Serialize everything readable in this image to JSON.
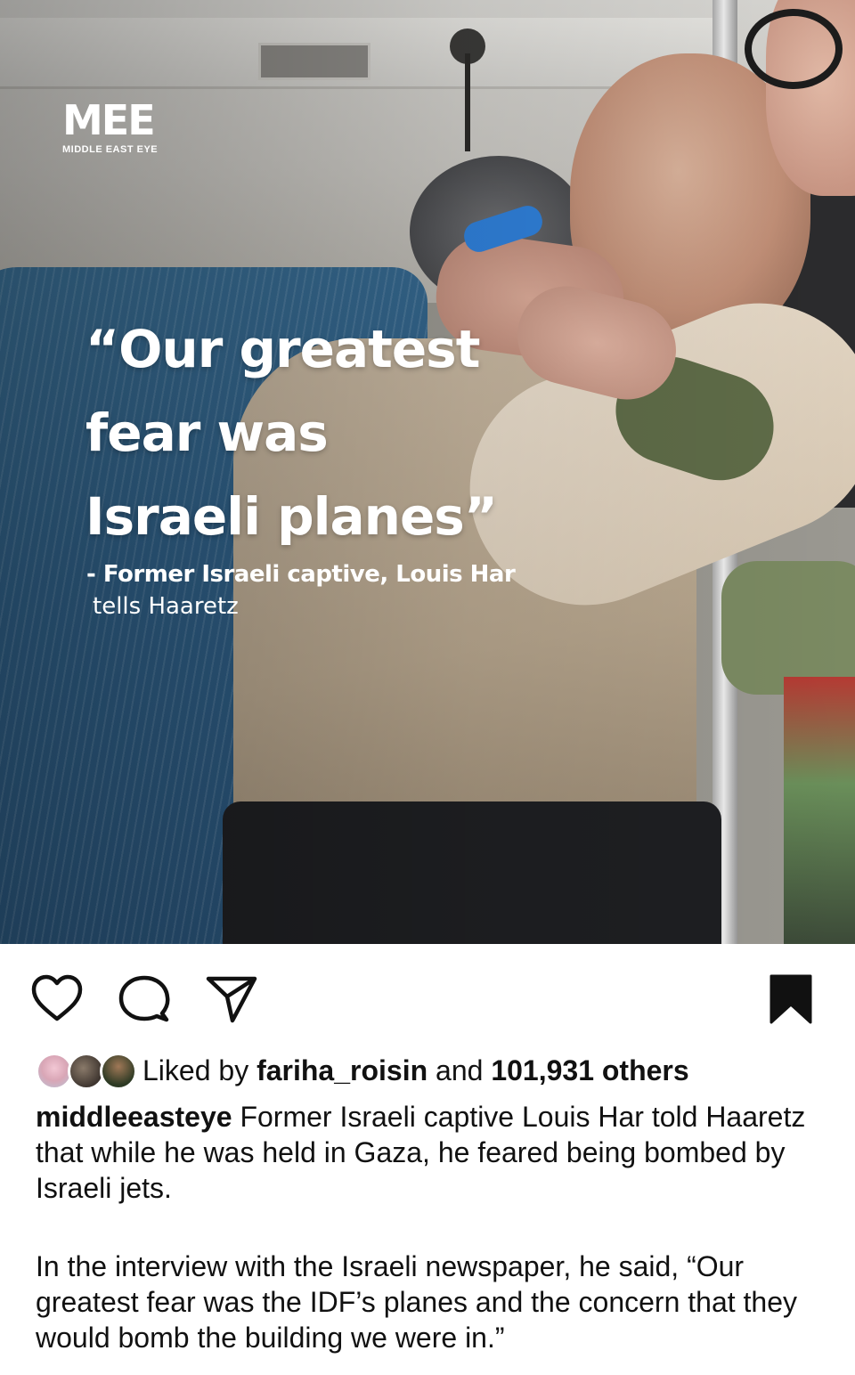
{
  "post_image": {
    "logo_mark": "MEE",
    "logo_text": "MIDDLE EAST EYE",
    "quote_lines": [
      "“Our greatest",
      "fear was",
      "Israeli planes”"
    ],
    "attribution": "- Former Israeli captive, Louis Har",
    "attribution_sub": "tells Haaretz"
  },
  "actions": {
    "like_icon": "heart-icon",
    "comment_icon": "comment-icon",
    "share_icon": "share-icon",
    "save_icon": "bookmark-icon"
  },
  "likes": {
    "prefix": "Liked by ",
    "user": "fariha_roisin",
    "middle": " and ",
    "count": "101,931 others"
  },
  "caption": {
    "username": "middleeasteye",
    "paragraph1": " Former Israeli captive Louis Har told Haaretz that while he was held in Gaza, he feared being bombed by Israeli jets.",
    "paragraph2": "In the interview with the Israeli newspaper, he said, “Our greatest fear was the IDF’s planes and the concern that they would bomb the building we were in.”"
  }
}
